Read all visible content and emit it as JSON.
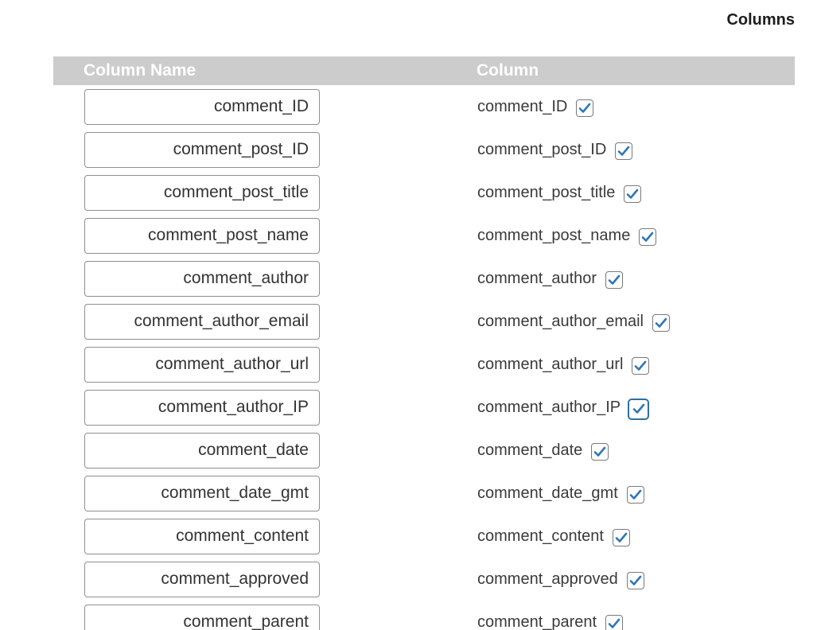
{
  "section": {
    "title": "Columns"
  },
  "table": {
    "headers": {
      "name": "Column Name",
      "column": "Column"
    },
    "check_color": "#2f77b8",
    "rows": [
      {
        "name": "comment_ID",
        "column": "comment_ID",
        "checked": true
      },
      {
        "name": "comment_post_ID",
        "column": "comment_post_ID",
        "checked": true
      },
      {
        "name": "comment_post_title",
        "column": "comment_post_title",
        "checked": true
      },
      {
        "name": "comment_post_name",
        "column": "comment_post_name",
        "checked": true
      },
      {
        "name": "comment_author",
        "column": "comment_author",
        "checked": true
      },
      {
        "name": "comment_author_email",
        "column": "comment_author_email",
        "checked": true
      },
      {
        "name": "comment_author_url",
        "column": "comment_author_url",
        "checked": true
      },
      {
        "name": "comment_author_IP",
        "column": "comment_author_IP",
        "checked": true,
        "focused": true
      },
      {
        "name": "comment_date",
        "column": "comment_date",
        "checked": true
      },
      {
        "name": "comment_date_gmt",
        "column": "comment_date_gmt",
        "checked": true
      },
      {
        "name": "comment_content",
        "column": "comment_content",
        "checked": true
      },
      {
        "name": "comment_approved",
        "column": "comment_approved",
        "checked": true
      },
      {
        "name": "comment_parent",
        "column": "comment_parent",
        "checked": true
      }
    ]
  }
}
